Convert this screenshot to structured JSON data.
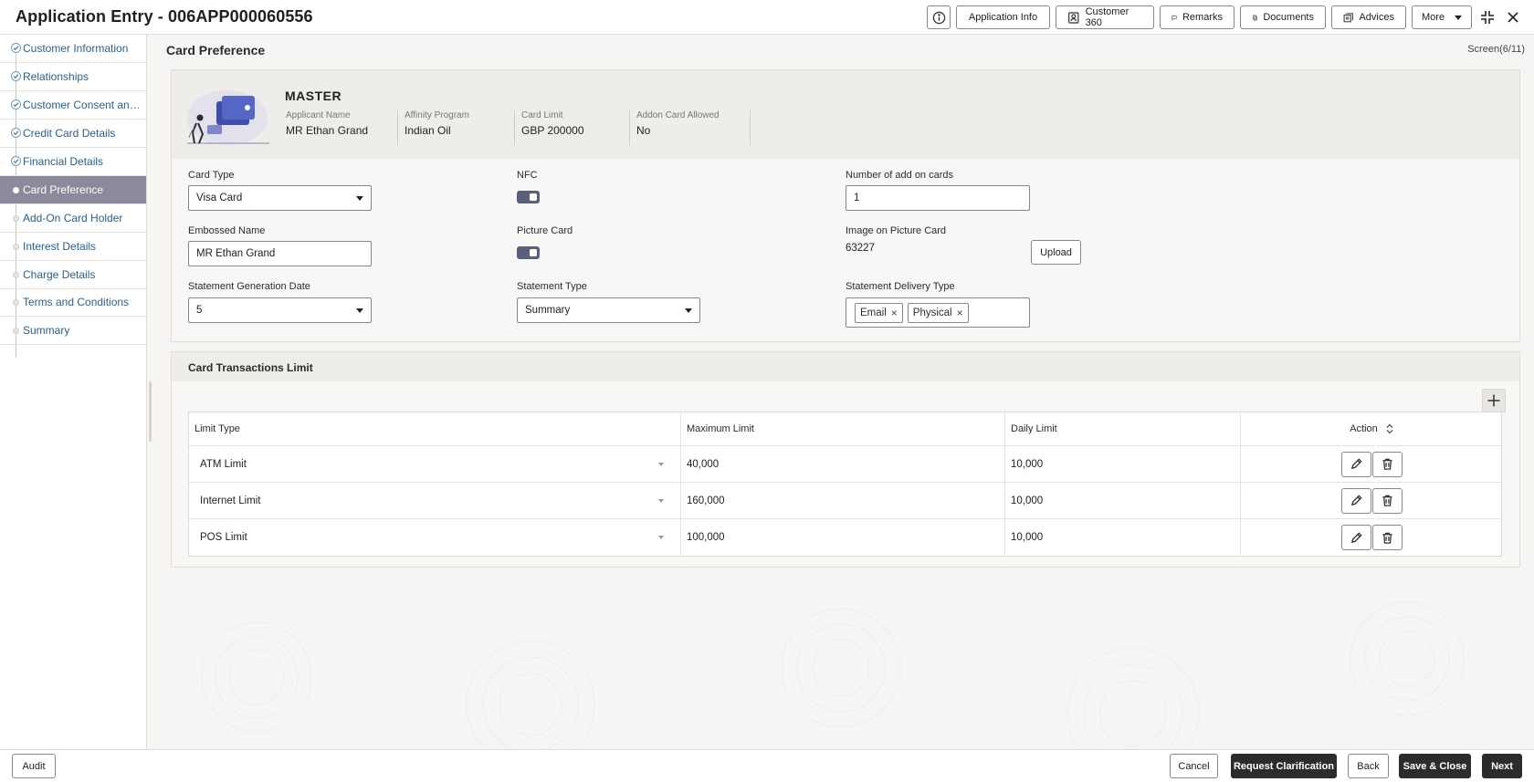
{
  "header": {
    "title": "Application Entry - 006APP000060556",
    "buttons": [
      {
        "label": "Application Info",
        "icon": "info-icon"
      },
      {
        "label": "Customer 360",
        "icon": "person-badge-icon"
      },
      {
        "label": "Remarks",
        "icon": "chat-bubble-icon"
      },
      {
        "label": "Documents",
        "icon": "documents-icon"
      },
      {
        "label": "Advices",
        "icon": "advices-icon"
      }
    ],
    "more_label": "More"
  },
  "sidebar": {
    "items": [
      {
        "label": "Customer Information",
        "state": "done"
      },
      {
        "label": "Relationships",
        "state": "done"
      },
      {
        "label": "Customer Consent and ...",
        "state": "done"
      },
      {
        "label": "Credit Card Details",
        "state": "done"
      },
      {
        "label": "Financial Details",
        "state": "done"
      },
      {
        "label": "Card Preference",
        "state": "active"
      },
      {
        "label": "Add-On Card Holder",
        "state": "pending"
      },
      {
        "label": "Interest Details",
        "state": "pending"
      },
      {
        "label": "Charge Details",
        "state": "pending"
      },
      {
        "label": "Terms and Conditions",
        "state": "pending"
      },
      {
        "label": "Summary",
        "state": "pending"
      }
    ]
  },
  "main": {
    "title": "Card Preference",
    "screen_count": "Screen(6/11)"
  },
  "card_info": {
    "name": "MASTER",
    "applicant_name_label": "Applicant Name",
    "applicant_name": "MR Ethan Grand",
    "affinity_label": "Affinity Program",
    "affinity": "Indian Oil",
    "limit_label": "Card Limit",
    "limit": "GBP 200000",
    "addon_label": "Addon Card Allowed",
    "addon": "No"
  },
  "form": {
    "card_type_label": "Card Type",
    "card_type": "Visa Card",
    "nfc_label": "NFC",
    "nfc_on": true,
    "addon_count_label": "Number of add on cards",
    "addon_count": "1",
    "embossed_label": "Embossed Name",
    "embossed": "MR Ethan Grand",
    "picture_card_label": "Picture Card",
    "picture_card_on": true,
    "image_label": "Image on Picture Card",
    "image_value": "63227",
    "upload_label": "Upload",
    "stmt_date_label": "Statement Generation Date",
    "stmt_date": "5",
    "stmt_type_label": "Statement Type",
    "stmt_type": "Summary",
    "delivery_label": "Statement Delivery Type",
    "delivery_chips": [
      "Email",
      "Physical"
    ]
  },
  "limits": {
    "title": "Card Transactions Limit",
    "columns": [
      "Limit Type",
      "Maximum Limit",
      "Daily Limit",
      "Action"
    ],
    "rows": [
      {
        "type": "ATM Limit",
        "max": "40,000",
        "daily": "10,000"
      },
      {
        "type": "Internet Limit",
        "max": "160,000",
        "daily": "10,000"
      },
      {
        "type": "POS Limit",
        "max": "100,000",
        "daily": "10,000"
      }
    ]
  },
  "footer": {
    "audit": "Audit",
    "cancel": "Cancel",
    "request": "Request Clarification",
    "back": "Back",
    "save_close": "Save & Close",
    "next": "Next"
  },
  "colors": {
    "active_nav": "#8b8a9c",
    "link": "#2b5f8a",
    "dark_button": "#2e2c2a",
    "toggle": "#5c5f7a"
  }
}
